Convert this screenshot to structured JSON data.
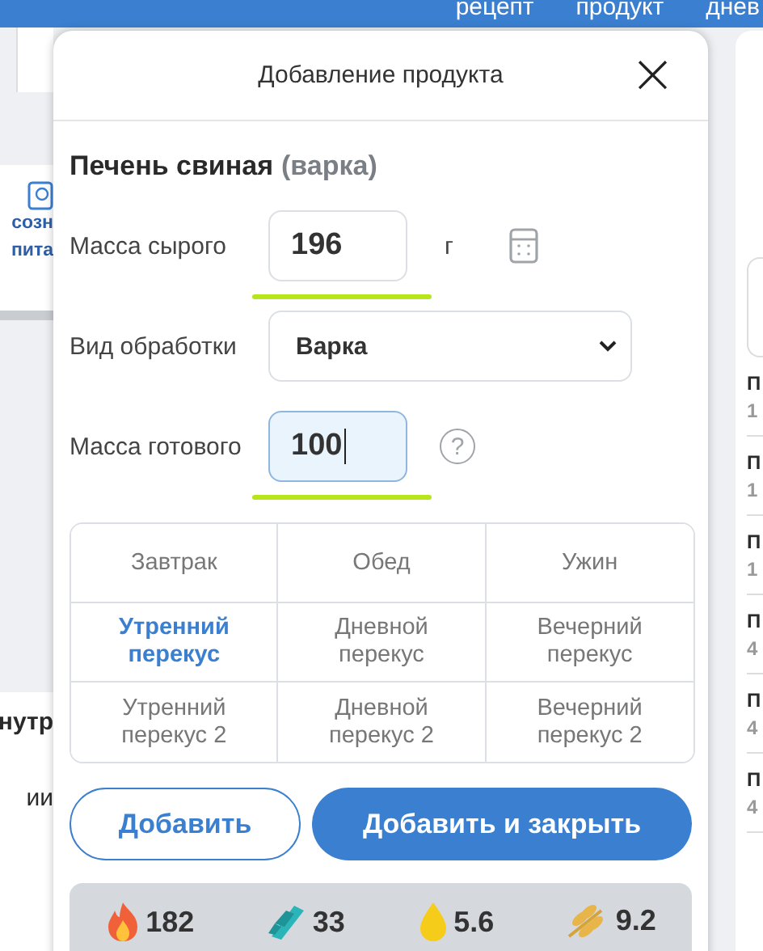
{
  "top_nav": [
    "рецепт",
    "продукт",
    "днев"
  ],
  "left_panel": {
    "tile_lines": [
      "созн",
      "пита"
    ],
    "heading": "нутр",
    "text": "ии"
  },
  "right_list": [
    {
      "title": "П",
      "value": "1"
    },
    {
      "title": "П",
      "value": "1"
    },
    {
      "title": "П",
      "value": "1"
    },
    {
      "title": "П",
      "value": "4"
    },
    {
      "title": "П",
      "value": "4"
    },
    {
      "title": "П",
      "value": "4"
    }
  ],
  "dialog": {
    "title": "Добавление продукта",
    "close": "×",
    "product": {
      "name": "Печень свиная",
      "method": "(варка)"
    },
    "fields": [
      {
        "kind": "number",
        "label": "Масса сырого",
        "value": "196",
        "unit": "г",
        "focused": false,
        "highlighted": true,
        "calculator": true
      },
      {
        "kind": "select",
        "label": "Вид обработки",
        "value": "Варка"
      },
      {
        "kind": "number",
        "label": "Масса готового",
        "value": "100",
        "focused": true,
        "highlighted": true,
        "help": "?"
      }
    ],
    "meals": [
      {
        "label": "Завтрак",
        "selected": false
      },
      {
        "label": "Обед",
        "selected": false
      },
      {
        "label": "Ужин",
        "selected": false
      },
      {
        "label": "Утренний перекус",
        "selected": true
      },
      {
        "label": "Дневной перекус",
        "selected": false
      },
      {
        "label": "Вечерний перекус",
        "selected": false
      },
      {
        "label": "Утренний перекус 2",
        "selected": false
      },
      {
        "label": "Дневной перекус 2",
        "selected": false
      },
      {
        "label": "Вечерний перекус 2",
        "selected": false
      }
    ],
    "buttons": [
      {
        "label": "Добавить",
        "kind": "secondary"
      },
      {
        "label": "Добавить и закрыть",
        "kind": "primary"
      }
    ],
    "nutrients": [
      {
        "kind": "calories",
        "value": "182"
      },
      {
        "kind": "protein",
        "value": "33"
      },
      {
        "kind": "fat",
        "value": "5.6"
      },
      {
        "kind": "carbs",
        "value": "9.2"
      }
    ]
  }
}
